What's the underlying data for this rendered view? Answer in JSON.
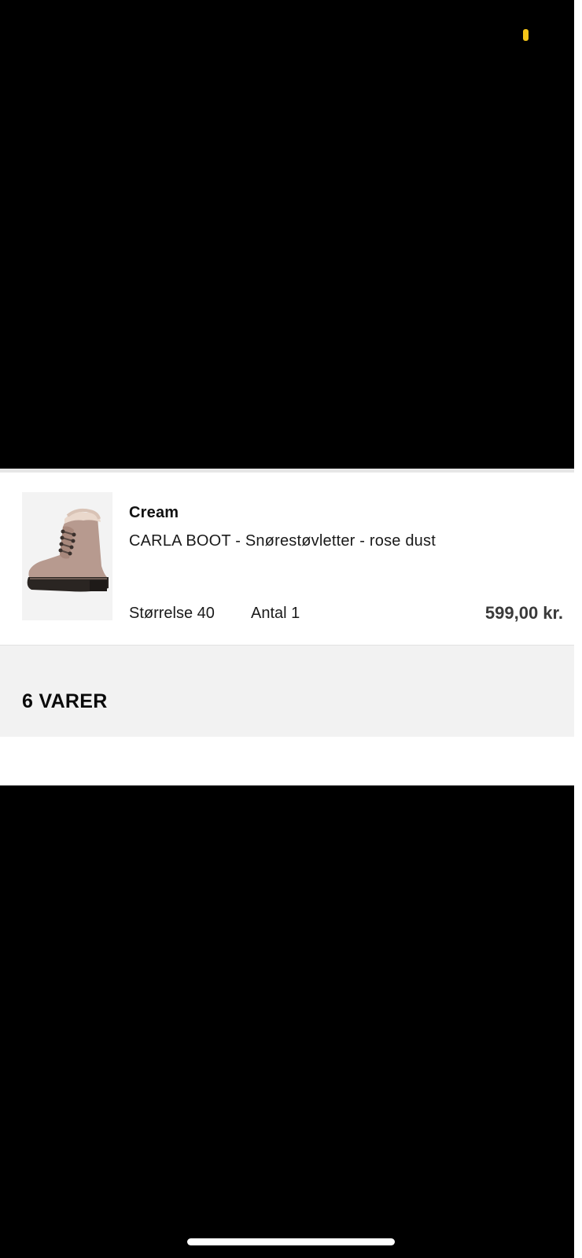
{
  "status": {
    "indicator_color": "#f5c518"
  },
  "cart_item": {
    "brand": "Cream",
    "name": "CARLA BOOT - Snørestøvletter - rose dust",
    "size": "Størrelse 40",
    "quantity": "Antal 1",
    "price": "599,00 kr.",
    "image_icon": "boot-image"
  },
  "summary": {
    "item_count": "6 VARER"
  }
}
